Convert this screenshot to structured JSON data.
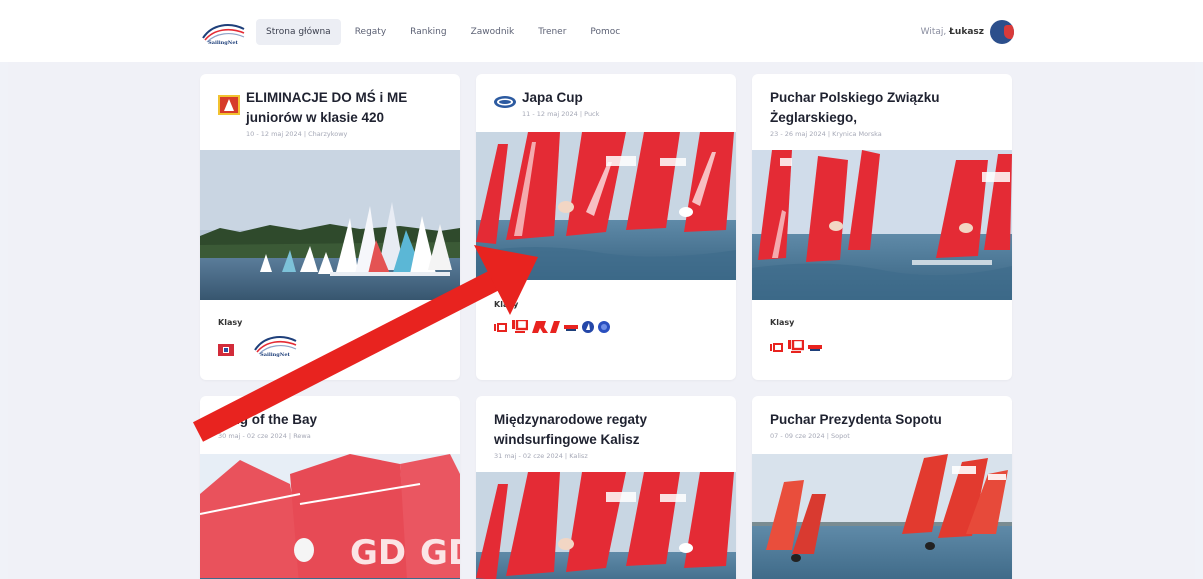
{
  "nav": {
    "brand": "SailingNet",
    "items": [
      "Strona główna",
      "Regaty",
      "Ranking",
      "Zawodnik",
      "Trener",
      "Pomoc"
    ],
    "active": "Strona główna"
  },
  "user": {
    "greeting": "Witaj,",
    "name": "Łukasz"
  },
  "classes_label": "Klasy",
  "regattas": [
    {
      "title": "ELIMINACJE DO MŚ i ME juniorów w klasie 420",
      "date_place": "10 - 12 maj 2024 | Charzykowy",
      "photo": "dinghy-fleet",
      "organizer_logo": "club-flag-logo",
      "class_icons": [
        "class-420-flag-icon",
        "sailingnet-logo"
      ]
    },
    {
      "title": "Japa Cup",
      "date_place": "11 - 12 maj 2024 | Puck",
      "photo": "windsurf-foil",
      "organizer_logo": "blue-oval-logo",
      "class_icons": [
        "iq-icon",
        "iq-foil-icon",
        "rs-x-icon",
        "techno-icon",
        "formula-blue-icon",
        "blue-disc-icon"
      ]
    },
    {
      "title": "Puchar Polskiego Związku Żeglarskiego,",
      "date_place": "23 - 26 maj 2024 | Krynica Morska",
      "photo": "windsurf-foil",
      "organizer_logo": "",
      "class_icons": [
        "iq-icon",
        "iq-foil-icon",
        "techno-icon"
      ]
    },
    {
      "title": "King of the Bay",
      "date_place": "30 maj - 02 cze 2024 | Rewa",
      "photo": "windsurf-closeup"
    },
    {
      "title": "Międzynarodowe regaty windsurfingowe Kalisz",
      "date_place": "31 maj - 02 cze 2024 | Kalisz",
      "photo": "windsurf-foil"
    },
    {
      "title": "Puchar Prezydenta Sopotu",
      "date_place": "07 - 09 cze 2024 | Sopot",
      "photo": "windsurf-distant"
    }
  ],
  "colors": {
    "page_bg": "#f0f2f8",
    "card_bg": "#ffffff",
    "accent_red": "#e8231f",
    "sail_red": "#e42b35",
    "water": "#4f7796",
    "navy": "#1e3f7a"
  }
}
